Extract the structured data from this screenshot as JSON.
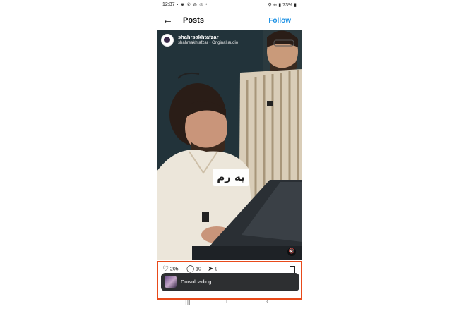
{
  "status_bar": {
    "time": "12:37",
    "left_icons": "▪ ◉ ✆ ◍ ◎ •",
    "right": "⚲ ≋ ▮ 73% ▮"
  },
  "header": {
    "back_icon": "arrow-left-icon",
    "title": "Posts",
    "follow": "Follow",
    "follow_color": "#1a8fe3"
  },
  "post": {
    "username": "shahrsakhtafzar",
    "audio": "shahrsakhtafzar • Original audio",
    "caption": "یه رم",
    "mute_icon": "🔇"
  },
  "actions": {
    "likes": "205",
    "comments": "10",
    "shares": "9"
  },
  "toast": {
    "text": "Downloading..."
  },
  "nav": {
    "recent": "|||",
    "home": "□",
    "back": "‹"
  },
  "colors": {
    "highlight": "#e84a1a"
  }
}
